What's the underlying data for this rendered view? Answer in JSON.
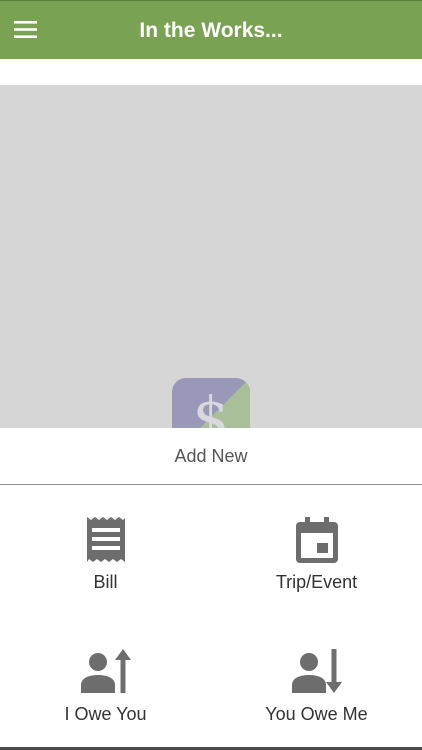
{
  "header": {
    "title": "In the Works...",
    "menu_icon": "hamburger-menu-icon",
    "background_color": "#7aa253"
  },
  "app_logo": {
    "icon": "dollar-sign-logo-icon",
    "colors": [
      "#9a98b9",
      "#a9bf9a"
    ]
  },
  "add_new_sheet": {
    "title": "Add New",
    "options": [
      {
        "label": "Bill",
        "icon": "receipt-icon"
      },
      {
        "label": "Trip/Event",
        "icon": "calendar-icon"
      },
      {
        "label": "I Owe You",
        "icon": "person-arrow-up-icon"
      },
      {
        "label": "You Owe Me",
        "icon": "person-arrow-down-icon"
      }
    ],
    "icon_color": "#6d6d6d"
  }
}
